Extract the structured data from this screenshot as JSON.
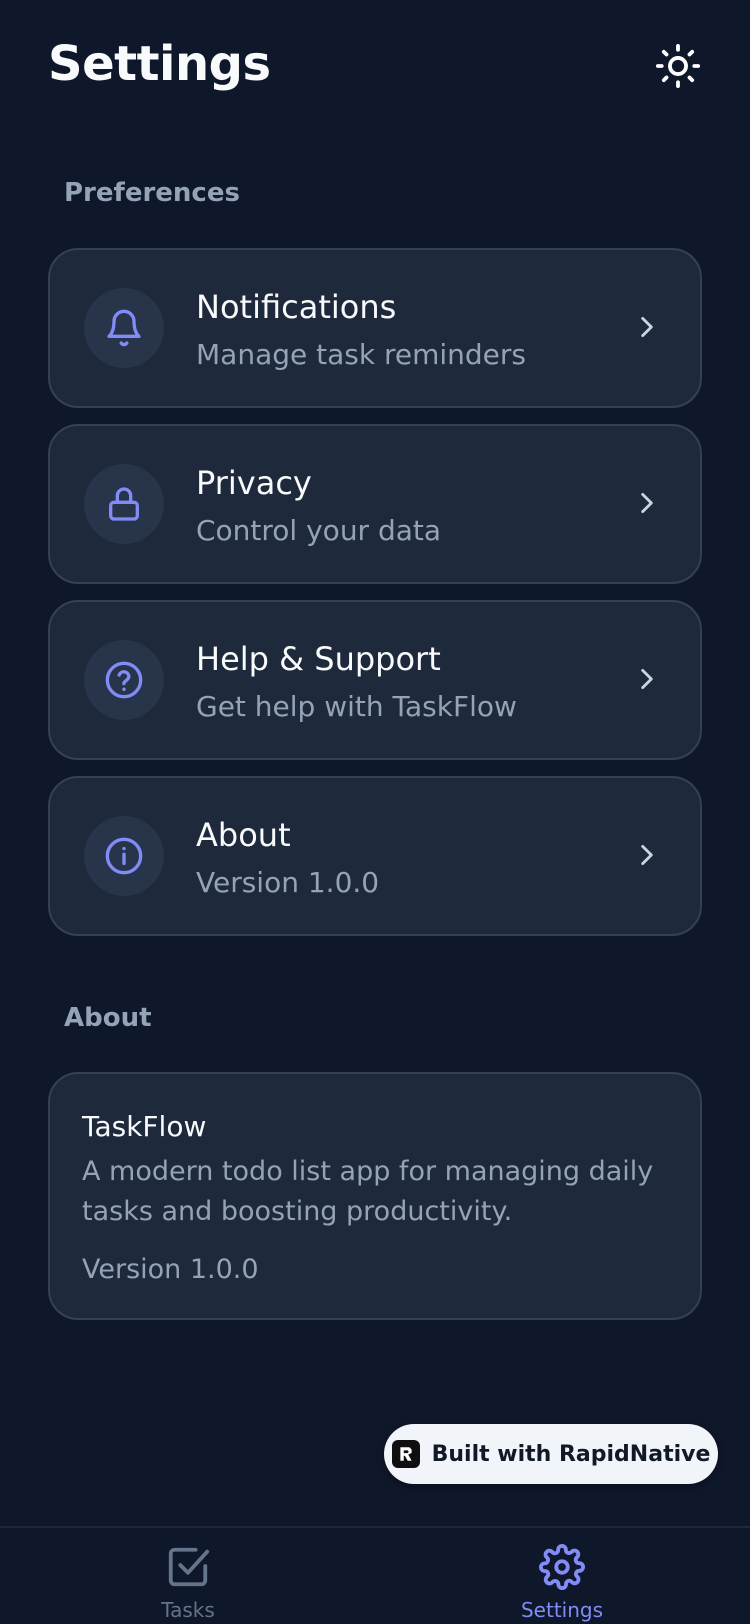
{
  "header": {
    "title": "Settings",
    "theme_icon": "sun-icon"
  },
  "sections": {
    "preferences_label": "Preferences",
    "about_label": "About"
  },
  "menu_items": [
    {
      "title": "Notifications",
      "subtitle": "Manage task reminders",
      "icon": "bell-icon"
    },
    {
      "title": "Privacy",
      "subtitle": "Control your data",
      "icon": "lock-icon"
    },
    {
      "title": "Help & Support",
      "subtitle": "Get help with TaskFlow",
      "icon": "help-circle-icon"
    },
    {
      "title": "About",
      "subtitle": "Version 1.0.0",
      "icon": "info-icon"
    }
  ],
  "about_card": {
    "app_name": "TaskFlow",
    "description": "A modern todo list app for managing daily tasks and boosting productivity.",
    "version": "Version 1.0.0"
  },
  "badge": {
    "label": "Built with RapidNative"
  },
  "tab_bar": {
    "tabs": [
      {
        "label": "Tasks",
        "icon": "checkbox-icon",
        "active": false
      },
      {
        "label": "Settings",
        "icon": "gear-icon",
        "active": true
      }
    ]
  },
  "colors": {
    "background": "#0f172a",
    "card": "#1e293b",
    "card_border": "#334155",
    "accent": "#818cf8",
    "muted_text": "#94a3b8"
  }
}
